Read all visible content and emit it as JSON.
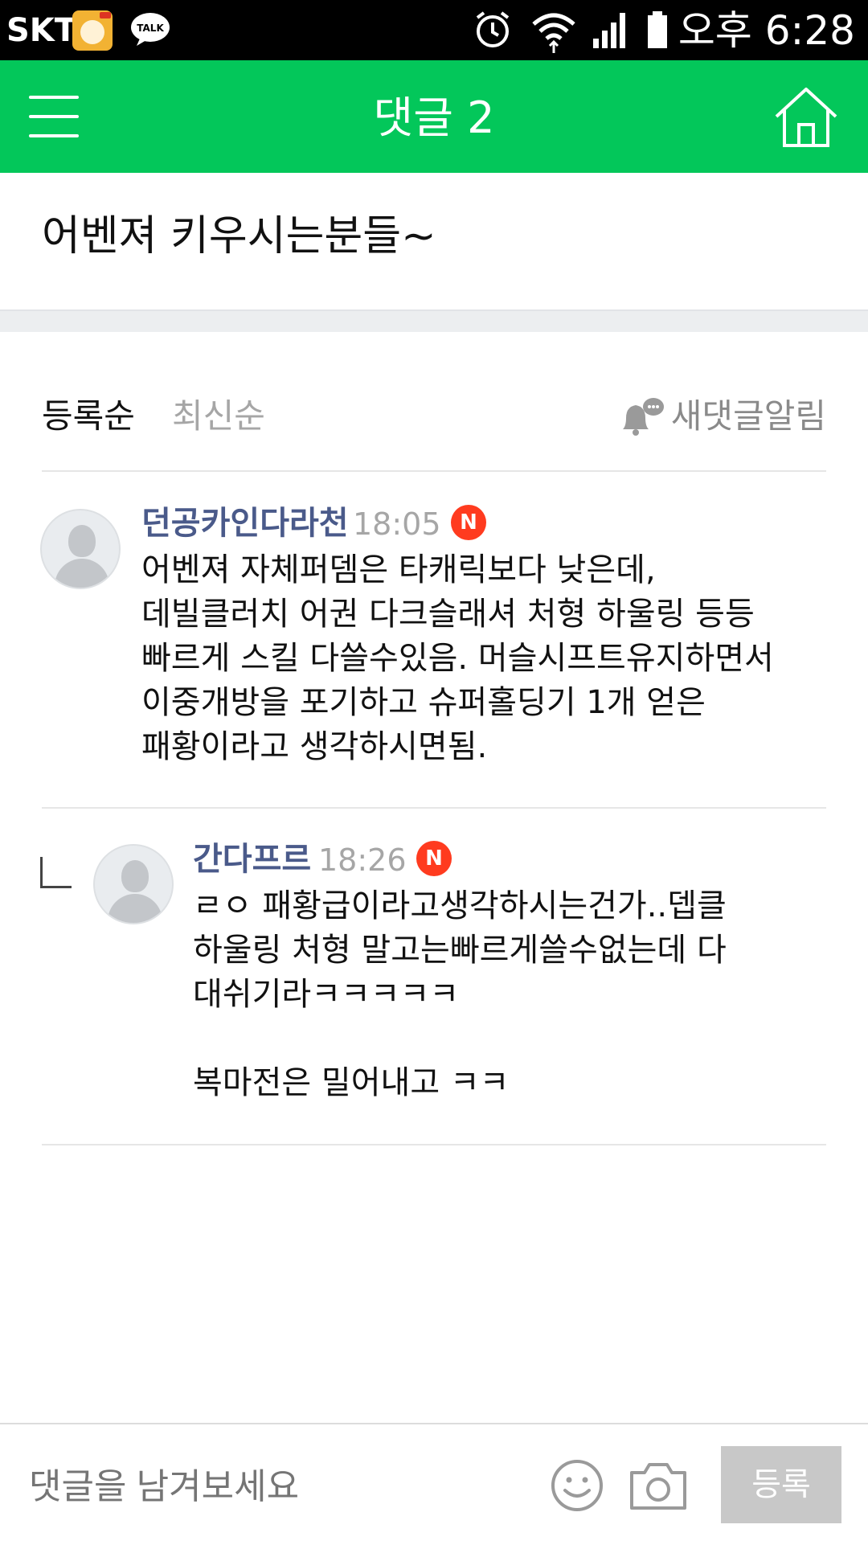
{
  "status_bar": {
    "carrier": "SKT",
    "talk_label": "TALK",
    "time": "오후 6:28"
  },
  "header": {
    "title": "댓글 2"
  },
  "post": {
    "title": "어벤져 키우시는분들~"
  },
  "sort": {
    "registered": "등록순",
    "latest": "최신순",
    "notify": "새댓글알림"
  },
  "comments": [
    {
      "author": "던공카인다라천",
      "time": "18:05",
      "badge": "N",
      "lines": [
        "어벤져 자체퍼뎀은 타캐릭보다 낮은데,",
        "데빌클러치 어권 다크슬래셔 처형 하울링 등등",
        "빠르게 스킬 다쓸수있음. 머슬시프트유지하면서",
        "이중개방을 포기하고 슈퍼홀딩기 1개 얻은",
        "패황이라고 생각하시면됨."
      ]
    },
    {
      "author": "간다프르",
      "time": "18:26",
      "badge": "N",
      "lines": [
        "ㄹㅇ 패황급이라고생각하시는건가..뎁클",
        "하울링 처형 말고는빠르게쓸수없는데 다",
        "대쉬기라ㅋㅋㅋㅋㅋ",
        "",
        "복마전은 밀어내고 ㅋㅋ"
      ]
    }
  ],
  "input": {
    "placeholder": "댓글을 남겨보세요",
    "submit": "등록"
  },
  "colors": {
    "header_green": "#03c75a",
    "author_blue": "#4a5a8a",
    "badge_red": "#ff3b1f"
  }
}
